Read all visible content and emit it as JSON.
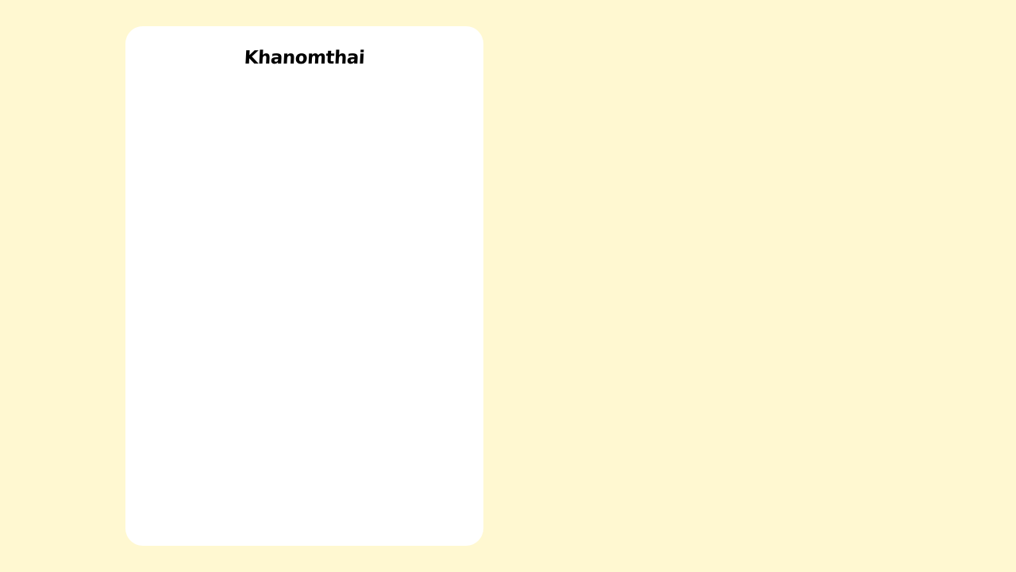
{
  "colors": {
    "page_background": "#fff8d1",
    "card_background": "#ffffff",
    "title_text": "#000000"
  },
  "card": {
    "title": "Khanomthai"
  }
}
